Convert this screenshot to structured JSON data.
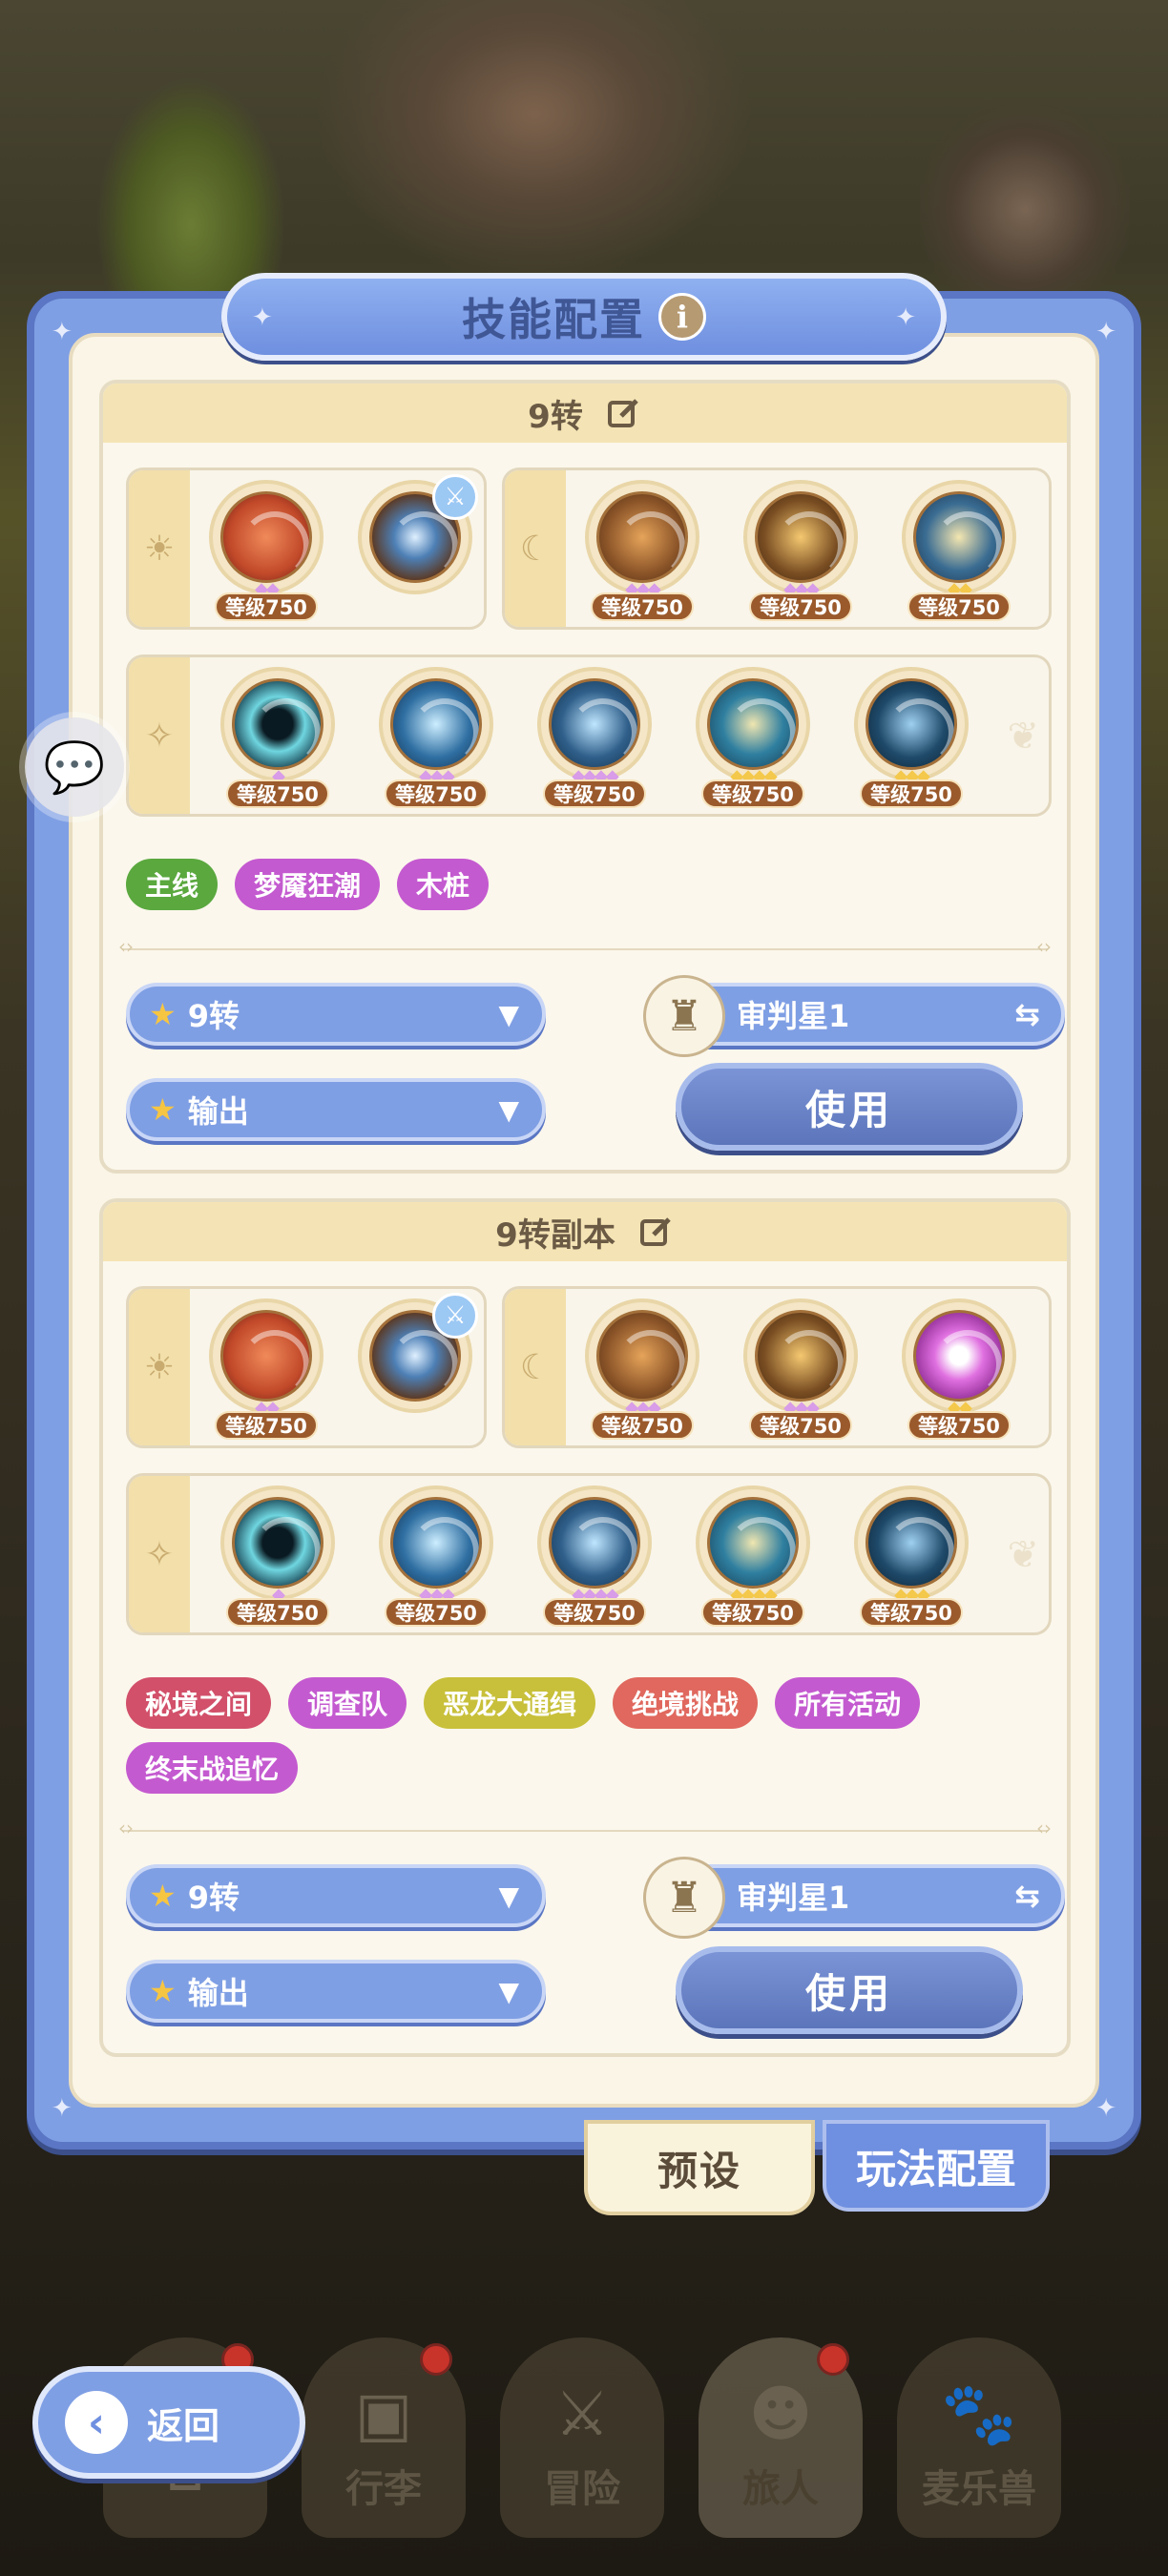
{
  "title": "技能配置",
  "info_icon": "i",
  "configs": [
    {
      "name": "9转",
      "day_skills": [
        {
          "level": "等级750",
          "color": "#c24a2a",
          "gems": "gold"
        },
        {
          "level": "",
          "color": "#5a3c2a",
          "gems": "none",
          "badge": "sword-icon"
        }
      ],
      "night_skills": [
        {
          "level": "等级750",
          "color": "#8b5428"
        },
        {
          "level": "等级750",
          "color": "#7a4e22"
        },
        {
          "level": "等级750",
          "color": "#3a6c92"
        }
      ],
      "star_skills": [
        {
          "level": "等级750",
          "color": "#1d4b5a"
        },
        {
          "level": "等级750",
          "color": "#2f6fa2"
        },
        {
          "level": "等级750",
          "color": "#2f5f8a"
        },
        {
          "level": "等级750",
          "color": "#2f7fa0"
        },
        {
          "level": "等级750",
          "color": "#1f4a6a"
        }
      ],
      "tags": [
        {
          "label": "主线",
          "color": "#5aa83e"
        },
        {
          "label": "梦魇狂潮",
          "color": "#c45ad0"
        },
        {
          "label": "木桩",
          "color": "#c45ad0"
        }
      ],
      "job_dropdown": "9转",
      "role_dropdown": "输出",
      "character": "审判星1",
      "use_label": "使用"
    },
    {
      "name": "9转副本",
      "day_skills": [
        {
          "level": "等级750",
          "color": "#c24a2a"
        },
        {
          "level": "",
          "color": "#5a3c2a",
          "badge": "sword-icon"
        }
      ],
      "night_skills": [
        {
          "level": "等级750",
          "color": "#8b5428"
        },
        {
          "level": "等级750",
          "color": "#7a4e22"
        },
        {
          "level": "等级750",
          "color": "#a03aa4"
        }
      ],
      "star_skills": [
        {
          "level": "等级750",
          "color": "#1d4b5a"
        },
        {
          "level": "等级750",
          "color": "#2f6fa2"
        },
        {
          "level": "等级750",
          "color": "#2f5f8a"
        },
        {
          "level": "等级750",
          "color": "#2f7fa0"
        },
        {
          "level": "等级750",
          "color": "#1f4a6a"
        }
      ],
      "tags": [
        {
          "label": "秘境之间",
          "color": "#d2506a"
        },
        {
          "label": "调查队",
          "color": "#c45ad0"
        },
        {
          "label": "恶龙大通缉",
          "color": "#c8c03a"
        },
        {
          "label": "绝境挑战",
          "color": "#e0685e"
        },
        {
          "label": "所有活动",
          "color": "#c45ad0"
        },
        {
          "label": "终末战追忆",
          "color": "#c45ad0"
        }
      ],
      "job_dropdown": "9转",
      "role_dropdown": "输出",
      "character": "审判星1",
      "use_label": "使用"
    }
  ],
  "tabs": {
    "preset": "预设",
    "play_config": "玩法配置"
  },
  "nav": [
    {
      "label": "",
      "icon": "home-icon"
    },
    {
      "label": "行李",
      "icon": "bag-icon"
    },
    {
      "label": "冒险",
      "icon": "swords-icon"
    },
    {
      "label": "旅人",
      "icon": "person-icon"
    },
    {
      "label": "麦乐兽",
      "icon": "pet-icon"
    }
  ],
  "back_label": "返回"
}
